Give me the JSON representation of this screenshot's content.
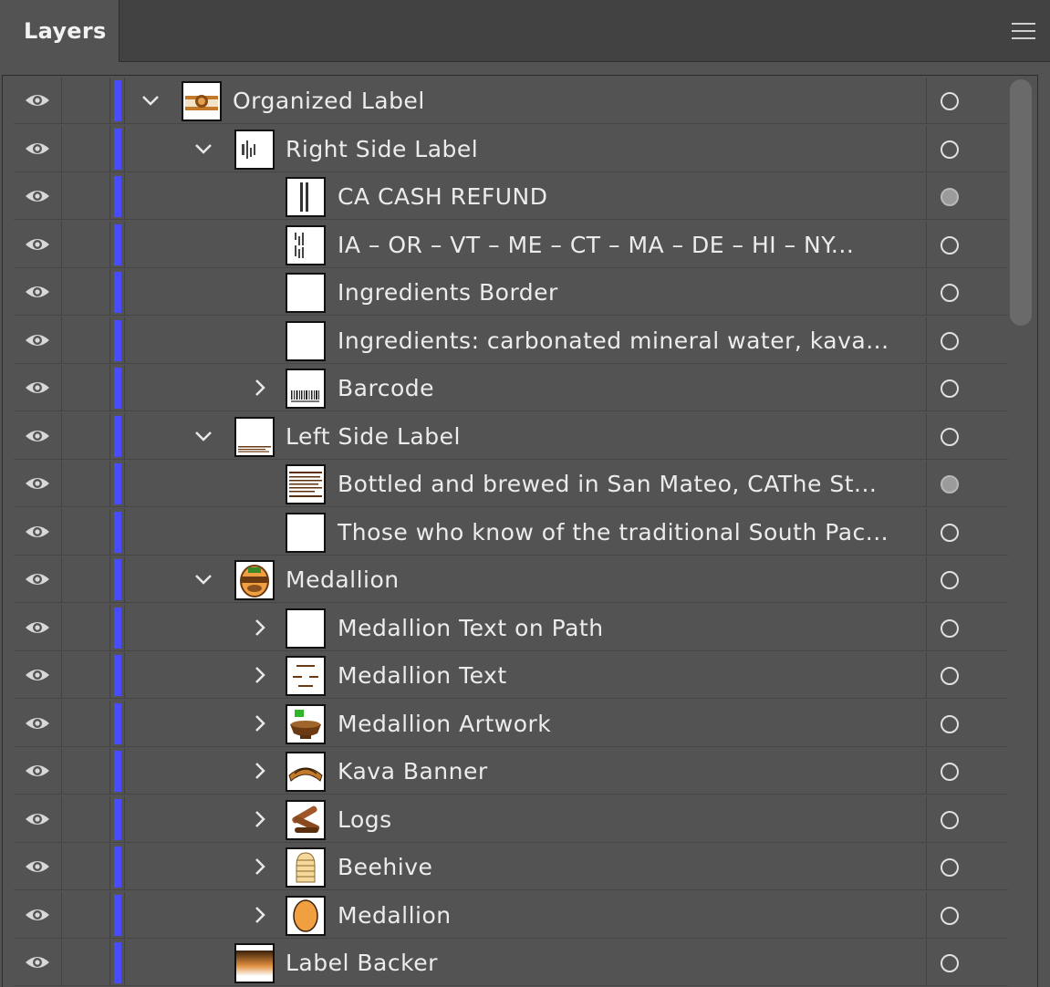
{
  "panel": {
    "tab_label": "Layers",
    "menu_icon": "hamburger-menu-icon"
  },
  "colors": {
    "layer_color": "#4a4cff",
    "panel_bg": "#535353",
    "header_bg": "#424242"
  },
  "icons": {
    "visibility": "eye-icon",
    "expanded": "chevron-down-icon",
    "collapsed": "chevron-right-icon",
    "target": "target-circle-icon"
  },
  "layers": [
    {
      "name": "Organized Label",
      "depth": 0,
      "toggle": "expanded",
      "thumb": "label",
      "selected": false
    },
    {
      "name": "Right Side Label",
      "depth": 1,
      "toggle": "expanded",
      "thumb": "text-right",
      "selected": false
    },
    {
      "name": "CA CASH REFUND",
      "depth": 2,
      "toggle": "none",
      "thumb": "vtext",
      "selected": true
    },
    {
      "name": "IA – OR – VT – ME – CT – MA – DE – HI – NY...",
      "depth": 2,
      "toggle": "none",
      "thumb": "text",
      "selected": false
    },
    {
      "name": "Ingredients Border",
      "depth": 2,
      "toggle": "none",
      "thumb": "blank",
      "selected": false
    },
    {
      "name": "Ingredients: carbonated mineral water, kava...",
      "depth": 2,
      "toggle": "none",
      "thumb": "blank",
      "selected": false
    },
    {
      "name": "Barcode",
      "depth": 2,
      "toggle": "collapsed",
      "thumb": "barcode",
      "selected": false
    },
    {
      "name": "Left Side Label",
      "depth": 1,
      "toggle": "expanded",
      "thumb": "text-bottom",
      "selected": false
    },
    {
      "name": "Bottled and brewed in San Mateo, CAThe St...",
      "depth": 2,
      "toggle": "none",
      "thumb": "paragraph",
      "selected": true
    },
    {
      "name": "Those who know of the traditional South Pac...",
      "depth": 2,
      "toggle": "none",
      "thumb": "blank",
      "selected": false
    },
    {
      "name": "Medallion",
      "depth": 1,
      "toggle": "expanded",
      "thumb": "medallion",
      "selected": false
    },
    {
      "name": "Medallion Text on Path",
      "depth": 2,
      "toggle": "collapsed",
      "thumb": "blank",
      "selected": false
    },
    {
      "name": "Medallion Text",
      "depth": 2,
      "toggle": "collapsed",
      "thumb": "text-small",
      "selected": false
    },
    {
      "name": "Medallion Artwork",
      "depth": 2,
      "toggle": "collapsed",
      "thumb": "bowl",
      "selected": false
    },
    {
      "name": "Kava Banner",
      "depth": 2,
      "toggle": "collapsed",
      "thumb": "banner",
      "selected": false
    },
    {
      "name": "Logs",
      "depth": 2,
      "toggle": "collapsed",
      "thumb": "logs",
      "selected": false
    },
    {
      "name": "Beehive",
      "depth": 2,
      "toggle": "collapsed",
      "thumb": "beehive",
      "selected": false
    },
    {
      "name": "Medallion",
      "depth": 2,
      "toggle": "collapsed",
      "thumb": "oval",
      "selected": false
    },
    {
      "name": "Label Backer",
      "depth": 1,
      "toggle": "none",
      "thumb": "gradient",
      "selected": false
    }
  ]
}
